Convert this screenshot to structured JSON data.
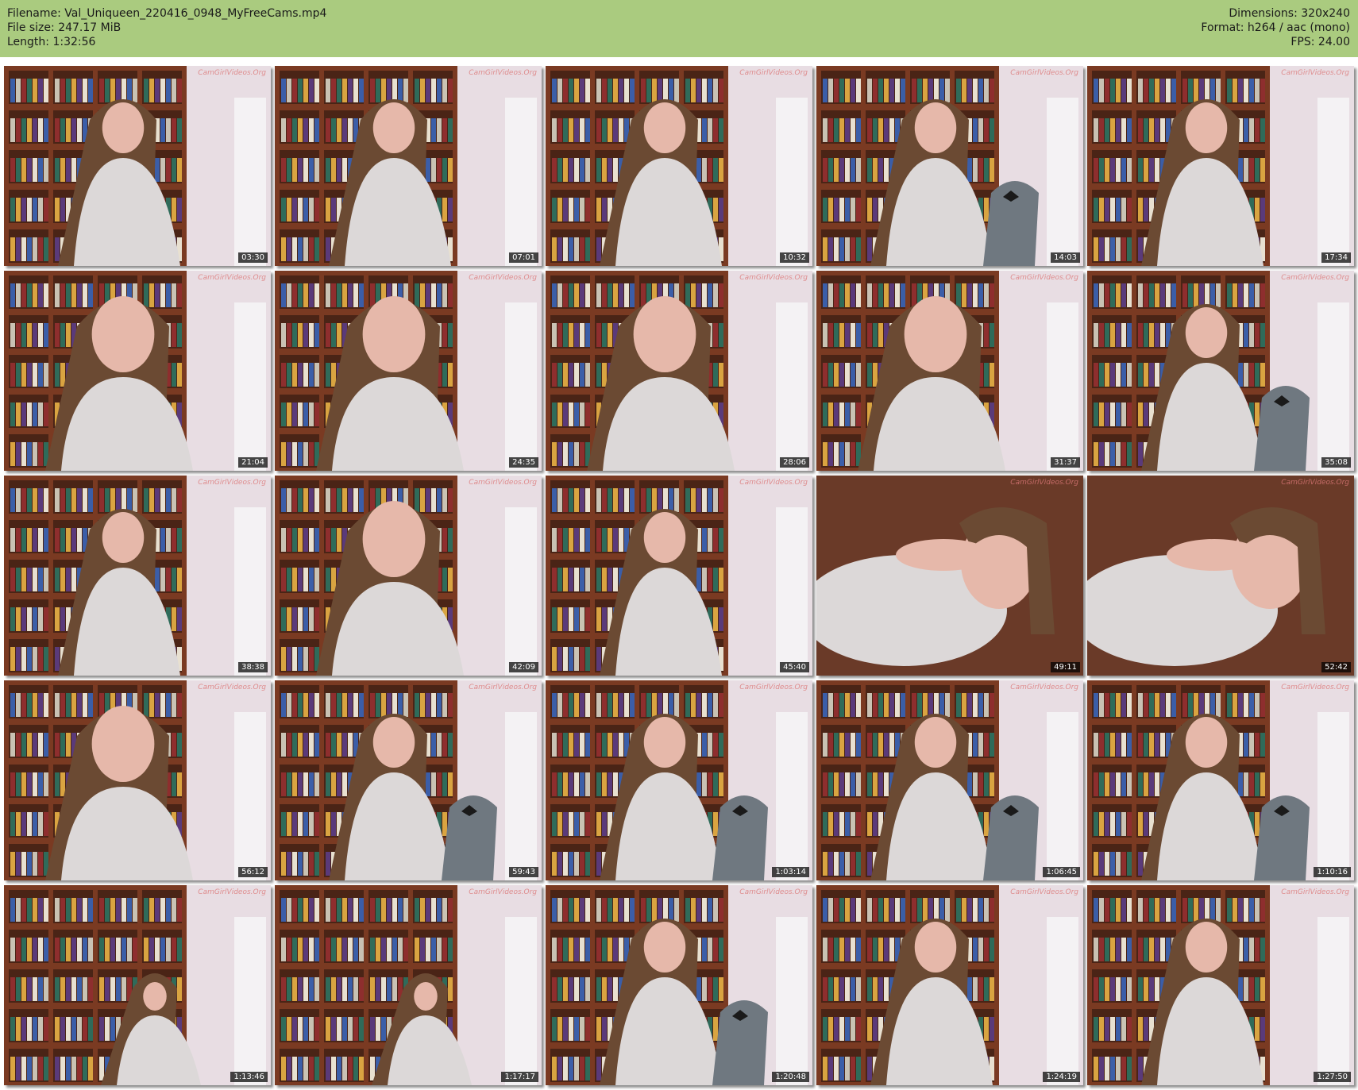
{
  "header": {
    "filename": "Filename: Val_Uniqueen_220416_0948_MyFreeCams.mp4",
    "file_size": "File size: 247.17 MiB",
    "length": "Length: 1:32:56",
    "dimensions": "Dimensions: 320x240",
    "format": "Format: h264 / aac (mono)",
    "fps": "FPS: 24.00"
  },
  "watermark": "CamGirlVideos.Org",
  "colors": {
    "header_bg": "#aacb7f",
    "wall": "#e8dde3",
    "shelf": "#7a3a22",
    "skin": "#e6b8aa",
    "hair": "#6b4a33",
    "top": "#dcd8d8",
    "sock": "#6f7880"
  },
  "thumbnails": [
    {
      "time": "03:30",
      "scene": "standing"
    },
    {
      "time": "07:01",
      "scene": "standing"
    },
    {
      "time": "10:32",
      "scene": "standing"
    },
    {
      "time": "14:03",
      "scene": "leg"
    },
    {
      "time": "17:34",
      "scene": "standing"
    },
    {
      "time": "21:04",
      "scene": "close"
    },
    {
      "time": "24:35",
      "scene": "close"
    },
    {
      "time": "28:06",
      "scene": "close"
    },
    {
      "time": "31:37",
      "scene": "close"
    },
    {
      "time": "35:08",
      "scene": "knee"
    },
    {
      "time": "38:38",
      "scene": "standing"
    },
    {
      "time": "42:09",
      "scene": "close"
    },
    {
      "time": "45:40",
      "scene": "standing"
    },
    {
      "time": "49:11",
      "scene": "lying"
    },
    {
      "time": "52:42",
      "scene": "lying"
    },
    {
      "time": "56:12",
      "scene": "close"
    },
    {
      "time": "59:43",
      "scene": "knee"
    },
    {
      "time": "1:03:14",
      "scene": "knee"
    },
    {
      "time": "1:06:45",
      "scene": "knee"
    },
    {
      "time": "1:10:16",
      "scene": "knee"
    },
    {
      "time": "1:13:46",
      "scene": "far"
    },
    {
      "time": "1:17:17",
      "scene": "far"
    },
    {
      "time": "1:20:48",
      "scene": "knee"
    },
    {
      "time": "1:24:19",
      "scene": "standing"
    },
    {
      "time": "1:27:50",
      "scene": "standing"
    }
  ]
}
